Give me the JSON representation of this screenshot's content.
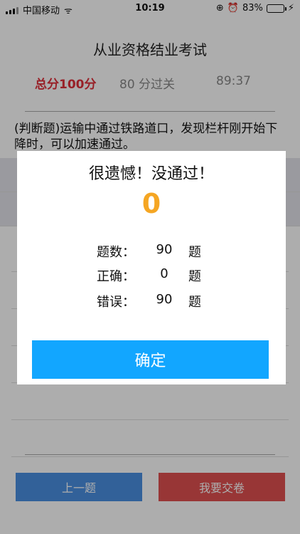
{
  "status_bar": {
    "carrier": "中国移动",
    "time": "10:19",
    "battery": "83%",
    "battery_fill": 0.83
  },
  "header": {
    "title": "从业资格结业考试",
    "total_score": "总分100分",
    "pass_score": "80 分过关",
    "timer": "89:37"
  },
  "question": {
    "text": "(判断题)运输中通过铁路道口，发现栏杆刚开始下降时，可以加速通过。"
  },
  "footer": {
    "prev_label": "上一题",
    "submit_label": "我要交卷"
  },
  "modal": {
    "title": "很遗憾！没通过！",
    "score": "0",
    "stats": [
      {
        "label": "题数：",
        "value": "90",
        "unit": "题"
      },
      {
        "label": "正确：",
        "value": "0",
        "unit": "题"
      },
      {
        "label": "错误：",
        "value": "90",
        "unit": "题"
      }
    ],
    "confirm_label": "确定"
  },
  "colors": {
    "score_red": "#e0303a",
    "confirm_blue": "#12a6ff",
    "result_orange": "#f5a623",
    "prev_blue": "#4a90e2",
    "submit_red": "#e05050"
  }
}
